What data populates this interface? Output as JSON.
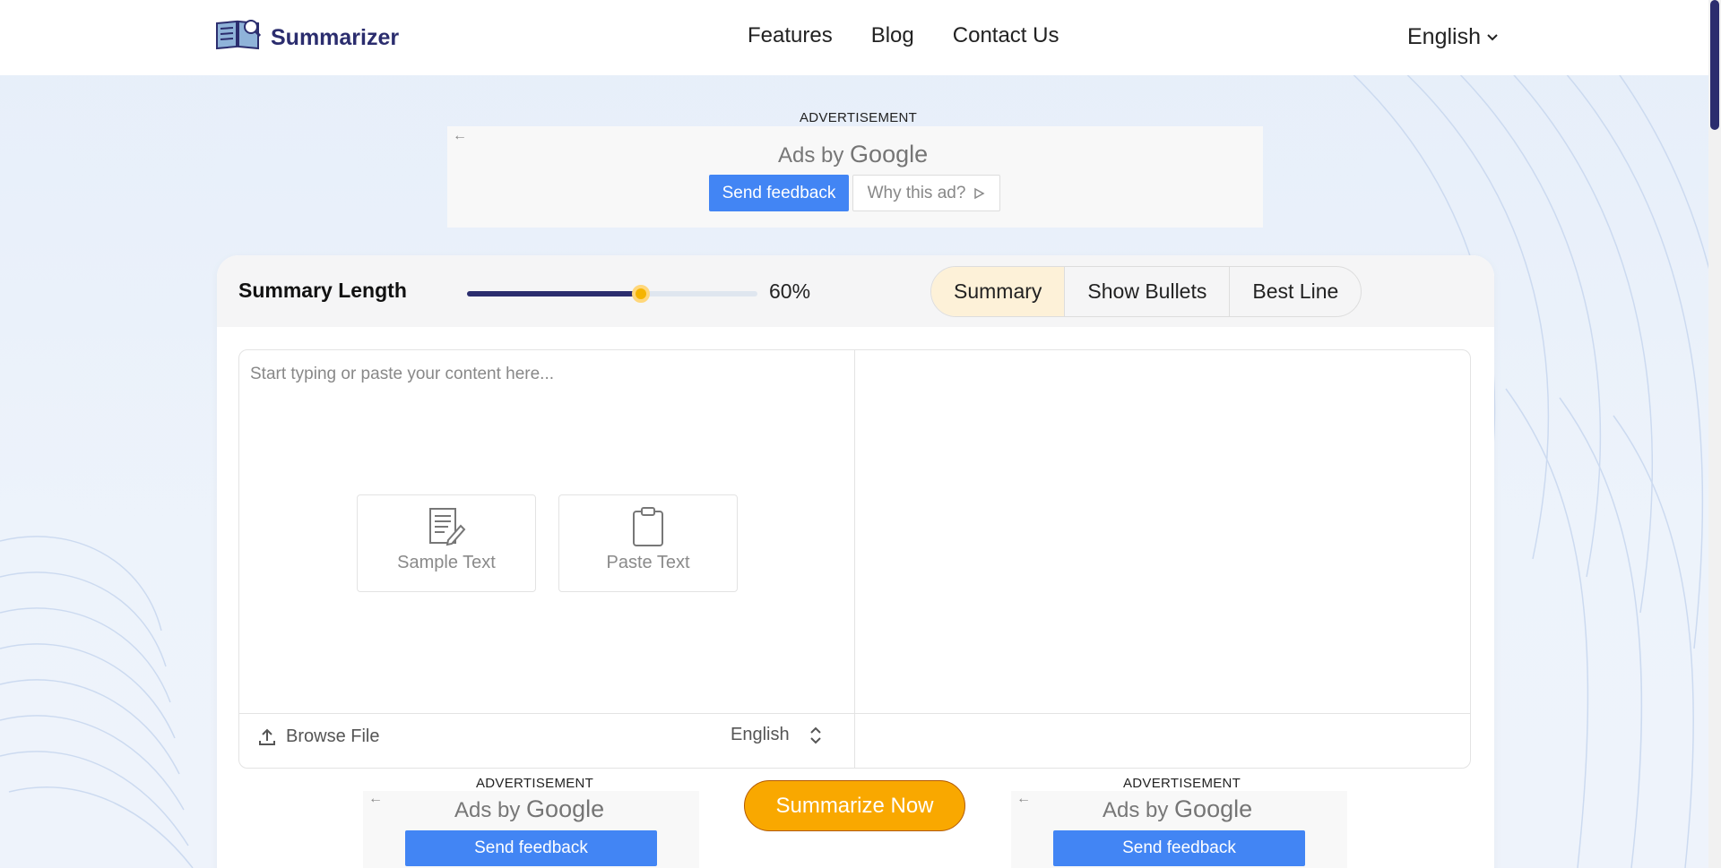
{
  "brand": {
    "name": "Summarizer",
    "accent": "#2b2d6e",
    "highlight": "#f9a800"
  },
  "nav": {
    "items": [
      "Features",
      "Blog",
      "Contact Us"
    ]
  },
  "language_selector": {
    "value": "English"
  },
  "ads": {
    "top": {
      "label": "ADVERTISEMENT",
      "ads_by": "Ads by",
      "google": "Google",
      "feedback": "Send feedback",
      "why": "Why this ad?"
    },
    "bottom_left": {
      "label": "ADVERTISEMENT",
      "ads_by": "Ads by",
      "google": "Google",
      "feedback": "Send feedback"
    },
    "bottom_right": {
      "label": "ADVERTISEMENT",
      "ads_by": "Ads by",
      "google": "Google",
      "feedback": "Send feedback"
    }
  },
  "summary": {
    "length_title": "Summary Length",
    "length_percent": 60,
    "length_label": "60%",
    "modes": [
      "Summary",
      "Show Bullets",
      "Best Line"
    ],
    "active_mode": "Summary"
  },
  "editor": {
    "placeholder": "Start typing or paste your content here...",
    "sample_label": "Sample Text",
    "paste_label": "Paste Text",
    "browse_label": "Browse File",
    "input_language": "English"
  },
  "actions": {
    "summarize": "Summarize Now"
  }
}
